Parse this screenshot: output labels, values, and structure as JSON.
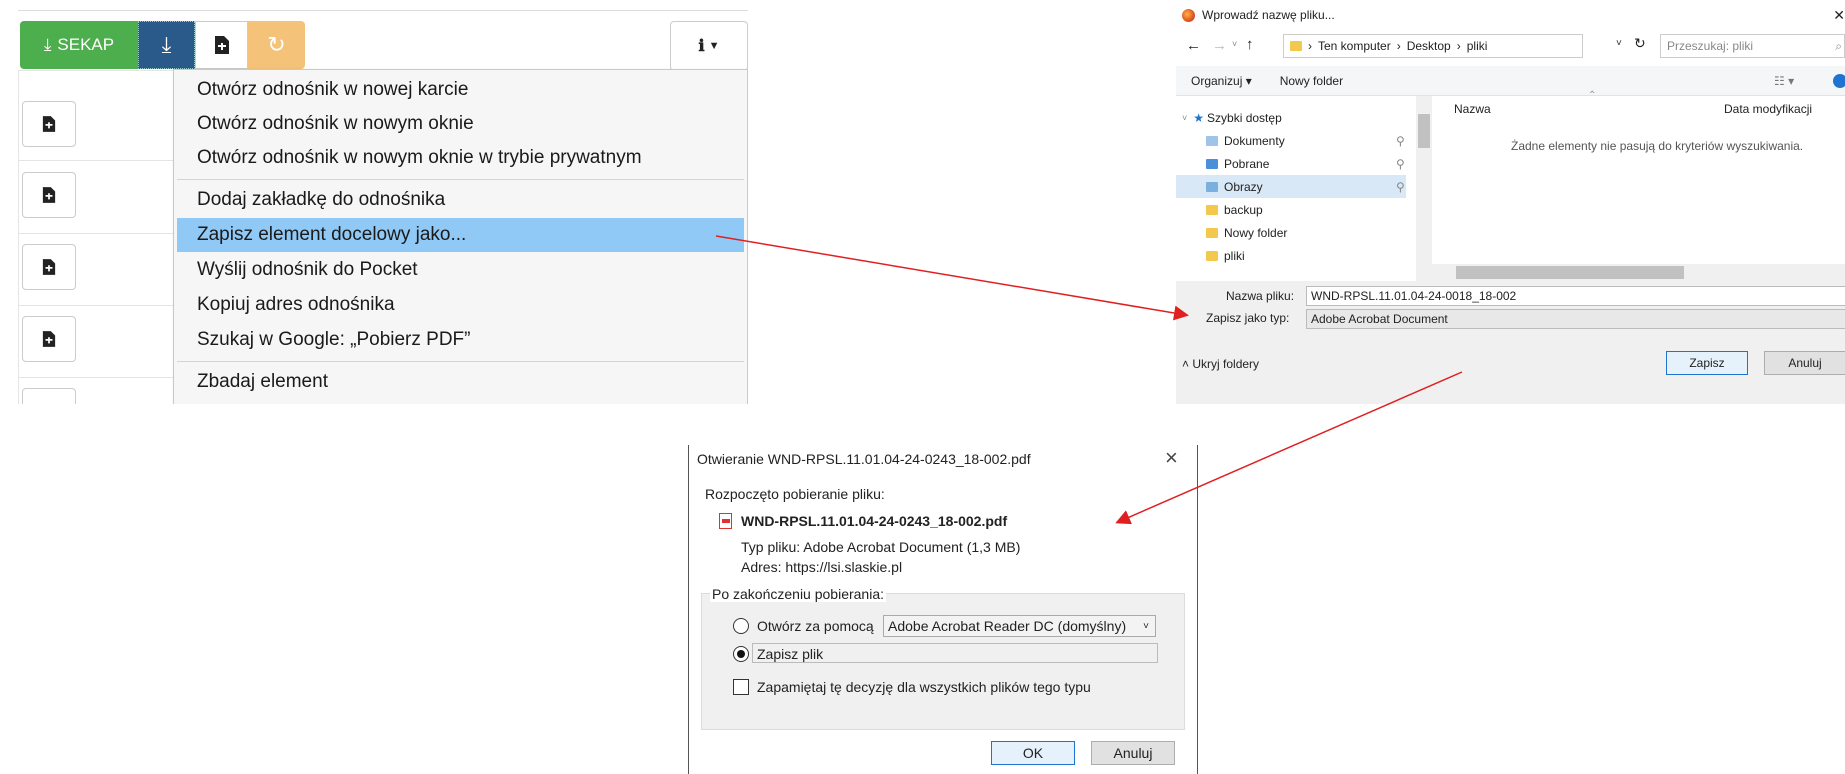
{
  "toolbar": {
    "sekap_label": "SEKAP"
  },
  "context_menu": {
    "items": [
      "Otwórz odnośnik w nowej karcie",
      "Otwórz odnośnik w nowym oknie",
      "Otwórz odnośnik w nowym oknie w trybie prywatnym",
      "Dodaj zakładkę do odnośnika",
      "Zapisz element docelowy jako...",
      "Wyślij odnośnik do Pocket",
      "Kopiuj adres odnośnika",
      "Szukaj w Google: „Pobierz PDF”",
      "Zbadaj element"
    ],
    "highlighted_index": 4
  },
  "save_dialog": {
    "title": "Wprowadź nazwę pliku...",
    "breadcrumb": [
      "Ten komputer",
      "Desktop",
      "pliki"
    ],
    "search_placeholder": "Przeszukaj: pliki",
    "organize_label": "Organizuj",
    "new_folder_label": "Nowy folder",
    "tree": {
      "quick_access": "Szybki dostęp",
      "items": [
        "Dokumenty",
        "Pobrane",
        "Obrazy",
        "backup",
        "Nowy folder",
        "pliki"
      ],
      "selected_index": 2
    },
    "columns": {
      "name": "Nazwa",
      "modified": "Data modyfikacji"
    },
    "empty_message": "Żadne elementy nie pasują do kryteriów wyszukiwania.",
    "filename_label": "Nazwa pliku:",
    "filename_value": "WND-RPSL.11.01.04-24-0018_18-002",
    "type_label": "Zapisz jako typ:",
    "type_value": "Adobe Acrobat Document",
    "hide_folders_label": "Ukryj foldery",
    "save_button": "Zapisz",
    "cancel_button": "Anuluj"
  },
  "open_dialog": {
    "title": "Otwieranie WND-RPSL.11.01.04-24-0243_18-002.pdf",
    "started_label": "Rozpoczęto pobieranie pliku:",
    "filename": "WND-RPSL.11.01.04-24-0243_18-002.pdf",
    "type_line": "Typ pliku: Adobe Acrobat Document (1,3 MB)",
    "address_line": "Adres: https://lsi.slaskie.pl",
    "group_label": "Po zakończeniu pobierania:",
    "open_with_label": "Otwórz za pomocą",
    "open_with_value": "Adobe Acrobat Reader DC (domyślny)",
    "save_file_label": "Zapisz plik",
    "selected_option": "save",
    "remember_label": "Zapamiętaj tę decyzję dla wszystkich plików tego typu",
    "ok_button": "OK",
    "cancel_button": "Anuluj"
  },
  "colors": {
    "sekap_green": "#4cae4c",
    "download_blue": "#2a5a8a",
    "refresh_orange": "#f5c27a",
    "menu_highlight": "#90c8f6",
    "arrow_red": "#e02020"
  }
}
